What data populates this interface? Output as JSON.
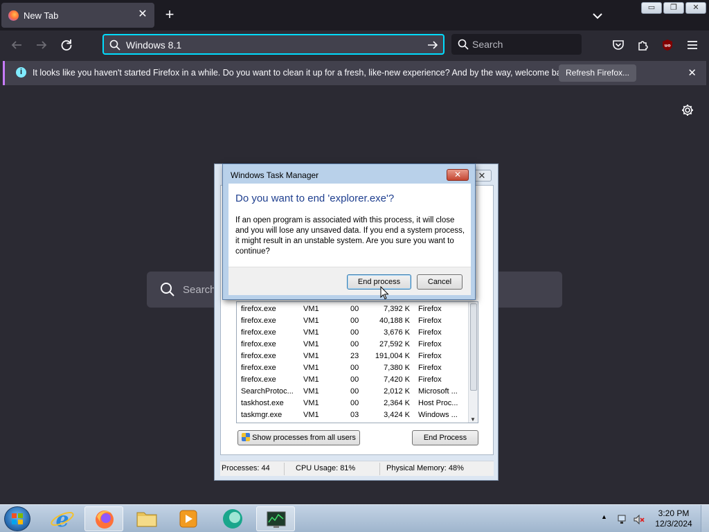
{
  "browser": {
    "tab_title": "New Tab",
    "url_value": "Windows 8.1",
    "search_placeholder": "Search",
    "newtab_search_placeholder": "Search",
    "notification": {
      "message": "It looks like you haven't started Firefox in a while. Do you want to clean it up for a fresh, like-new experience? And by the way, welcome back!",
      "refresh_label": "Refresh Firefox..."
    }
  },
  "dialog": {
    "title": "Windows Task Manager",
    "heading": "Do you want to end 'explorer.exe'?",
    "content": "If an open program is associated with this process, it will close and you will lose any unsaved data. If you end a system process, it might result in an unstable system. Are you sure you want to continue?",
    "end_label": "End process",
    "cancel_label": "Cancel"
  },
  "task_manager": {
    "processes": [
      {
        "name": "firefox.exe",
        "user": "VM1",
        "cpu": "00",
        "mem": "7,392 K",
        "desc": "Firefox"
      },
      {
        "name": "firefox.exe",
        "user": "VM1",
        "cpu": "00",
        "mem": "40,188 K",
        "desc": "Firefox"
      },
      {
        "name": "firefox.exe",
        "user": "VM1",
        "cpu": "00",
        "mem": "3,676 K",
        "desc": "Firefox"
      },
      {
        "name": "firefox.exe",
        "user": "VM1",
        "cpu": "00",
        "mem": "27,592 K",
        "desc": "Firefox"
      },
      {
        "name": "firefox.exe",
        "user": "VM1",
        "cpu": "23",
        "mem": "191,004 K",
        "desc": "Firefox"
      },
      {
        "name": "firefox.exe",
        "user": "VM1",
        "cpu": "00",
        "mem": "7,380 K",
        "desc": "Firefox"
      },
      {
        "name": "firefox.exe",
        "user": "VM1",
        "cpu": "00",
        "mem": "7,420 K",
        "desc": "Firefox"
      },
      {
        "name": "SearchProtoc...",
        "user": "VM1",
        "cpu": "00",
        "mem": "2,012 K",
        "desc": "Microsoft ..."
      },
      {
        "name": "taskhost.exe",
        "user": "VM1",
        "cpu": "00",
        "mem": "2,364 K",
        "desc": "Host Proc..."
      },
      {
        "name": "taskmgr.exe",
        "user": "VM1",
        "cpu": "03",
        "mem": "3,424 K",
        "desc": "Windows ..."
      }
    ],
    "show_all_label": "Show processes from all users",
    "end_process_label": "End Process",
    "status": {
      "processes": "Processes: 44",
      "cpu": "CPU Usage: 81%",
      "memory": "Physical Memory: 48%"
    }
  },
  "taskbar": {
    "time": "3:20 PM",
    "date": "12/3/2024"
  },
  "icons": [
    "firefox-icon",
    "close-icon",
    "plus-icon",
    "chevron-down-icon",
    "back-arrow-icon",
    "forward-arrow-icon",
    "reload-icon",
    "search-icon",
    "arrow-right-icon",
    "pocket-icon",
    "extensions-icon",
    "ublock-icon",
    "hamburger-menu-icon",
    "info-icon",
    "gear-icon",
    "windows-start-icon",
    "internet-explorer-icon",
    "folder-icon",
    "media-player-icon",
    "task-manager-icon"
  ]
}
